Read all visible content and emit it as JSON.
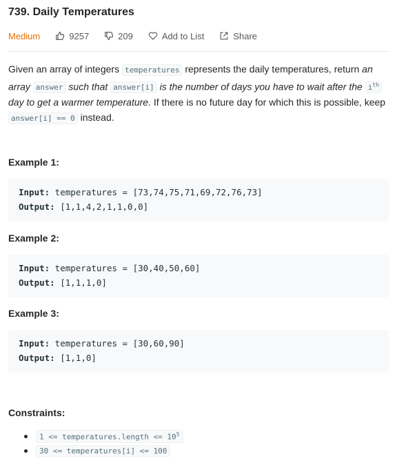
{
  "problem": {
    "title": "739. Daily Temperatures",
    "difficulty": "Medium",
    "likes": "9257",
    "dislikes": "209",
    "add_to_list": "Add to List",
    "share": "Share"
  },
  "description": {
    "p1": "Given an array of integers ",
    "c1": "temperatures",
    "p2": " represents the daily temperatures, return ",
    "i1": "an array ",
    "c2": "answer",
    "i2": " such that ",
    "c3": "answer[i]",
    "i3": " is the number of days you have to wait after the ",
    "c4": "i",
    "sup": "th",
    "i4": " day to get a warmer temperature",
    "p3": ". If there is no future day for which this is possible, keep ",
    "c5": "answer[i] == 0",
    "p4": " instead."
  },
  "examples": [
    {
      "title": "Example 1:",
      "input_label": "Input:",
      "input": " temperatures = [73,74,75,71,69,72,76,73]",
      "output_label": "Output:",
      "output": " [1,1,4,2,1,1,0,0]"
    },
    {
      "title": "Example 2:",
      "input_label": "Input:",
      "input": " temperatures = [30,40,50,60]",
      "output_label": "Output:",
      "output": " [1,1,1,0]"
    },
    {
      "title": "Example 3:",
      "input_label": "Input:",
      "input": " temperatures = [30,60,90]",
      "output_label": "Output:",
      "output": " [1,1,0]"
    }
  ],
  "constraints": {
    "title": "Constraints:",
    "items": [
      {
        "text": "1 <= temperatures.length <= 10",
        "sup": "5"
      },
      {
        "text": "30 <= temperatures[i] <= 100",
        "sup": ""
      }
    ]
  },
  "colors": {
    "difficulty_medium": "#ef6c00",
    "code_bg": "#f7f9fa"
  },
  "icons": {
    "like": "thumbs-up-icon",
    "dislike": "thumbs-down-icon",
    "add_to_list": "heart-icon",
    "share": "share-icon"
  }
}
